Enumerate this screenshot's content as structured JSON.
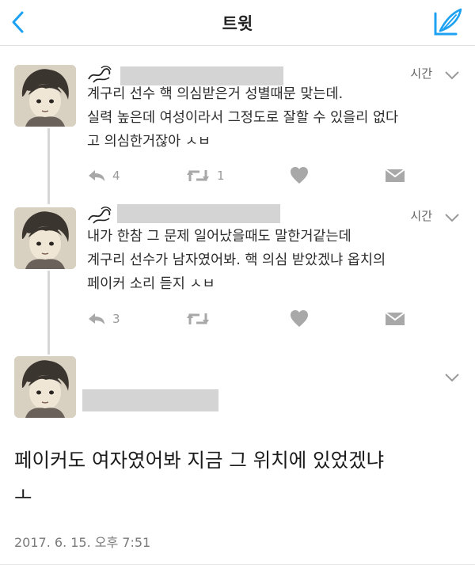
{
  "header": {
    "title": "트윗",
    "back_icon": "chevron-left-icon",
    "compose_icon": "compose-feather-icon",
    "accent_color": "#1da1f2"
  },
  "tweets": [
    {
      "time": "시간",
      "text": "계구리 선수 핵 의심받은거 성별때문 맞는데.\n실력 높은데 여성이라서 그정도로 잘할 수 있을리 없다\n고 의심한거잖아 ㅅㅂ",
      "reply_count": "4",
      "retweet_count": "1"
    },
    {
      "time": "시간",
      "text": "내가 한참 그 문제 일어났을때도 말한거같는데\n계구리 선수가 남자였어봐. 핵 의심 받았겠냐 옵치의\n페이커 소리 듣지 ㅅㅂ",
      "reply_count": "3",
      "retweet_count": ""
    }
  ],
  "main_tweet": {
    "text": "페이커도 여자였어봐 지금 그 위치에 있었겠냐\nㅗ",
    "timestamp": "2017. 6. 15. 오후 7:51"
  }
}
